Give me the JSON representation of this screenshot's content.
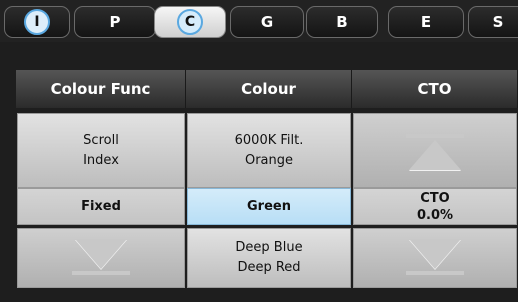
{
  "tabs": [
    {
      "label": "I",
      "circled": true,
      "active": false
    },
    {
      "label": "P",
      "circled": false,
      "active": false
    },
    {
      "label": "C",
      "circled": true,
      "active": true
    },
    {
      "label": "G",
      "circled": false,
      "active": false
    },
    {
      "label": "B",
      "circled": false,
      "active": false
    },
    {
      "label": "E",
      "circled": false,
      "active": false
    },
    {
      "label": "S",
      "circled": false,
      "active": false
    }
  ],
  "columns": [
    {
      "header": "Colour Func",
      "scroll_up_lines": [
        "Scroll",
        "Index"
      ],
      "value": "Fixed",
      "scroll_down_lines": []
    },
    {
      "header": "Colour",
      "scroll_up_lines": [
        "6000K Filt.",
        "Orange"
      ],
      "value": "Green",
      "scroll_down_lines": [
        "Deep Blue",
        "Deep Red"
      ]
    },
    {
      "header": "CTO",
      "scroll_up_lines": [],
      "value_lines": [
        "CTO",
        "0.0%"
      ],
      "scroll_down_lines": []
    }
  ],
  "colors": {
    "selected": "#c6e6f8",
    "circle_border": "#5aa8e0"
  }
}
